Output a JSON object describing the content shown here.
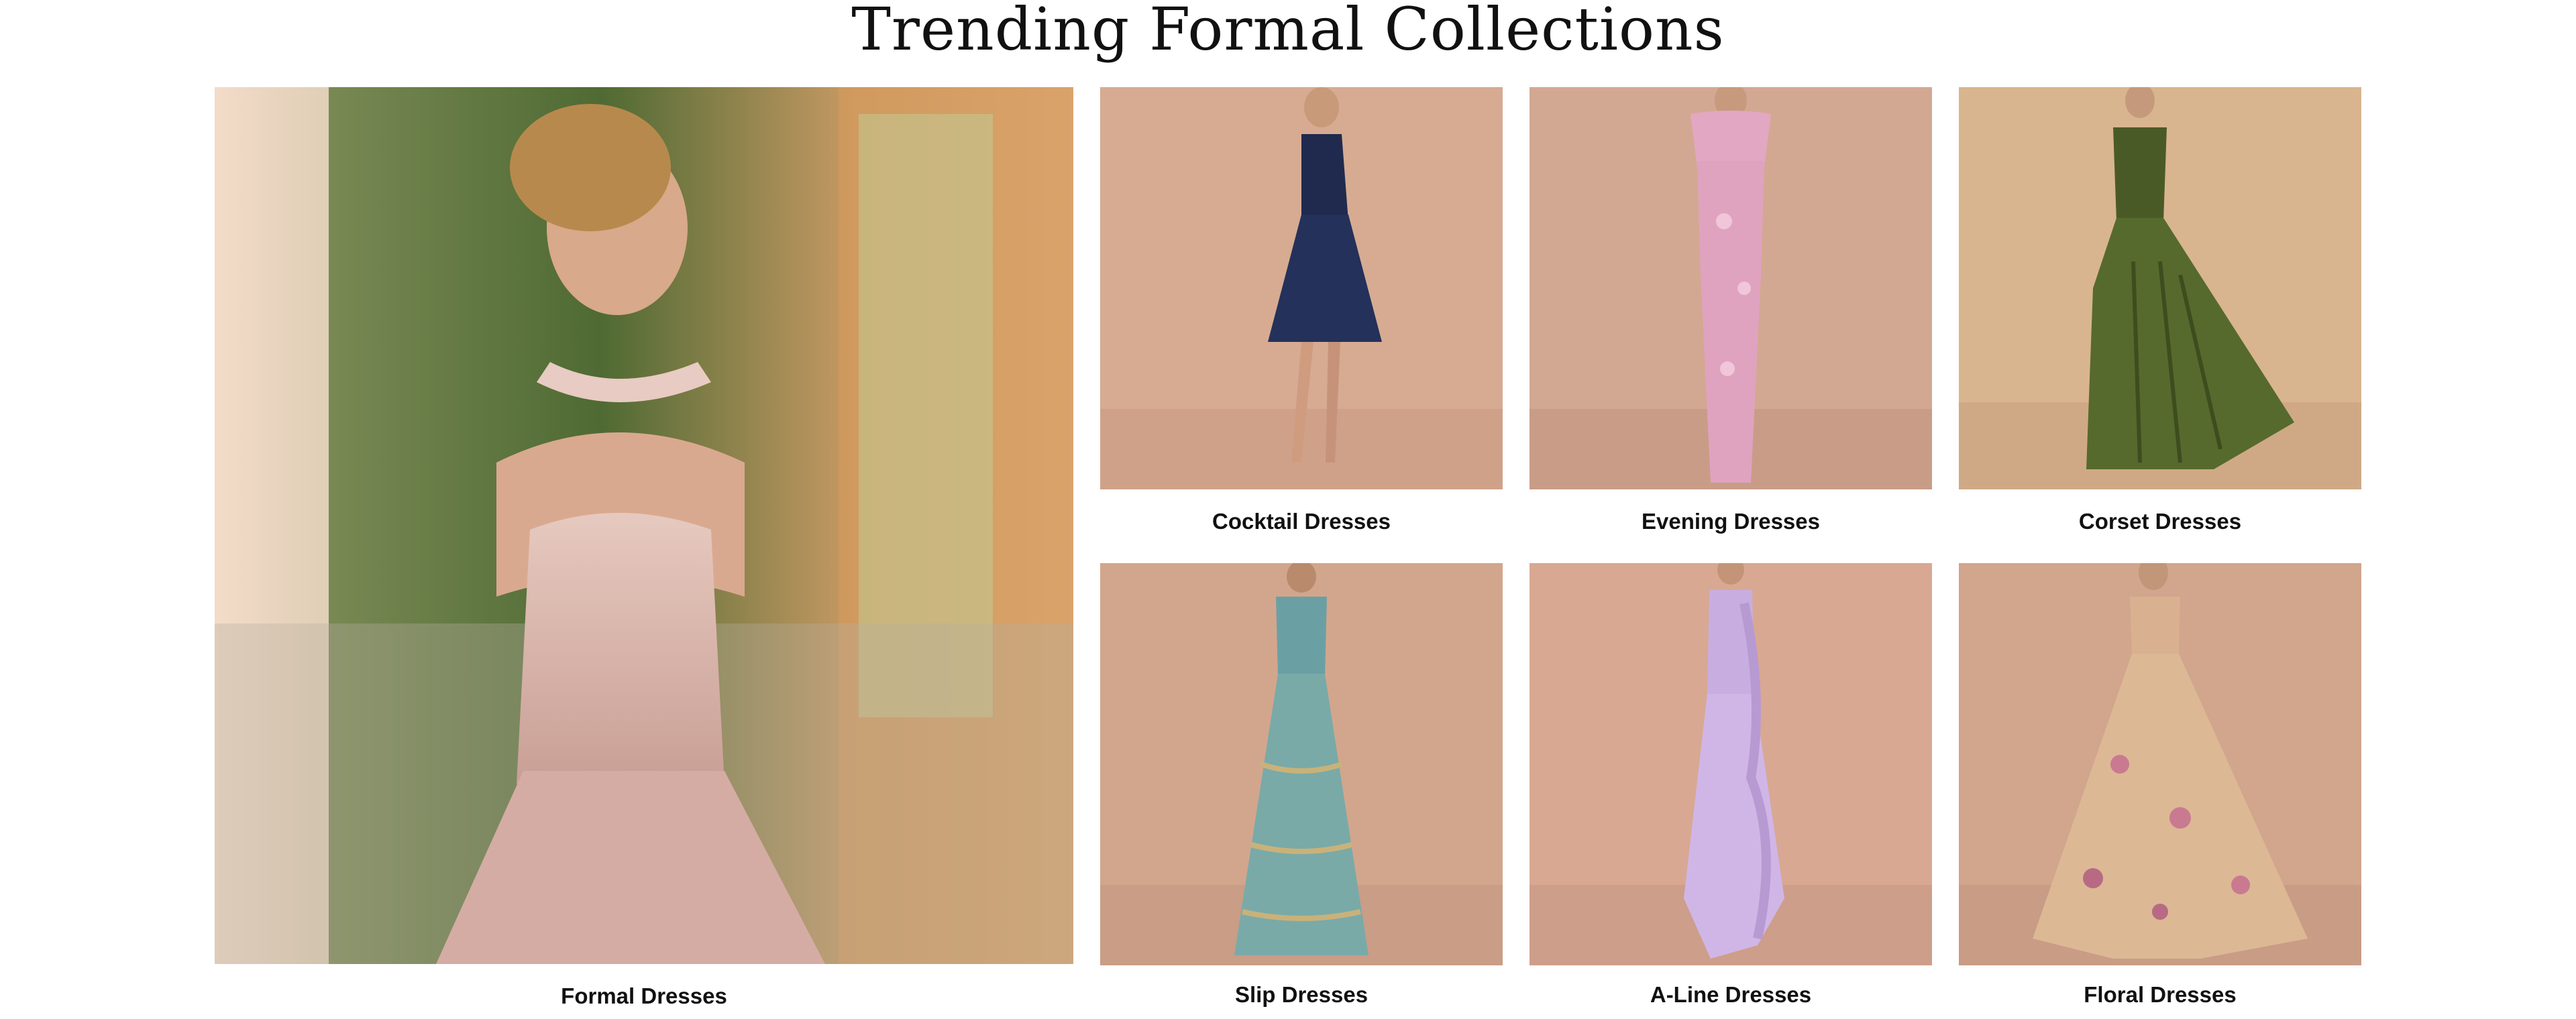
{
  "page": {
    "title": "Trending Formal Collections"
  },
  "collections": [
    {
      "label": "Formal Dresses",
      "dress_color": "#d9b7ae",
      "bg": "#c9a37e"
    },
    {
      "label": "Cocktail Dresses",
      "dress_color": "#1f2a4e",
      "bg": "#d6ab92"
    },
    {
      "label": "Evening Dresses",
      "dress_color": "#dfa3c0",
      "bg": "#d3a892"
    },
    {
      "label": "Corset Dresses",
      "dress_color": "#4a5a26",
      "bg": "#d8b58e"
    },
    {
      "label": "Slip Dresses",
      "dress_color": "#6aa0a4",
      "bg": "#d2a68d"
    },
    {
      "label": "A-Line Dresses",
      "dress_color": "#c8aee0",
      "bg": "#d8a893"
    },
    {
      "label": "Floral Dresses",
      "dress_color": "#d9b090",
      "bg": "#d2a58d"
    }
  ]
}
